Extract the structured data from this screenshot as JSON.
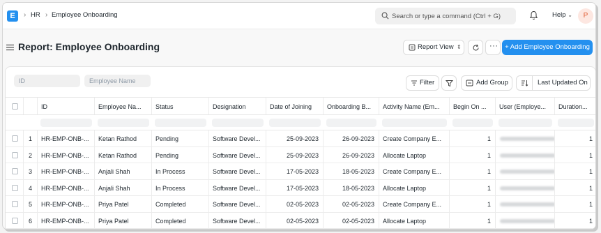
{
  "navbar": {
    "logo_letter": "E",
    "breadcrumbs": [
      "HR",
      "Employee Onboarding"
    ],
    "search_placeholder": "Search or type a command (Ctrl + G)",
    "help_label": "Help",
    "avatar_initial": "P"
  },
  "page": {
    "title": "Report: Employee Onboarding",
    "view_selector": "Report View",
    "add_button": "+ Add Employee Onboarding"
  },
  "toolbar": {
    "id_placeholder": "ID",
    "name_placeholder": "Employee Name",
    "filter_label": "Filter",
    "add_group_label": "Add Group",
    "sort_label": "Last Updated On"
  },
  "table": {
    "columns": [
      "ID",
      "Employee Na...",
      "Status",
      "Designation",
      "Date of Joining",
      "Onboarding B...",
      "Activity Name (Em...",
      "Begin On ...",
      "User (Employe...",
      "Duration..."
    ],
    "rows": [
      {
        "n": "1",
        "id": "HR-EMP-ONB-...",
        "name": "Ketan Rathod",
        "status": "Pending",
        "designation": "Software Devel...",
        "doj": "25-09-2023",
        "onb": "26-09-2023",
        "activity": "Create Company E...",
        "begin": "1",
        "duration": "1"
      },
      {
        "n": "2",
        "id": "HR-EMP-ONB-...",
        "name": "Ketan Rathod",
        "status": "Pending",
        "designation": "Software Devel...",
        "doj": "25-09-2023",
        "onb": "26-09-2023",
        "activity": "Allocate Laptop",
        "begin": "1",
        "duration": "1"
      },
      {
        "n": "3",
        "id": "HR-EMP-ONB-...",
        "name": "Anjali Shah",
        "status": "In Process",
        "designation": "Software Devel...",
        "doj": "17-05-2023",
        "onb": "18-05-2023",
        "activity": "Create Company E...",
        "begin": "1",
        "duration": "1"
      },
      {
        "n": "4",
        "id": "HR-EMP-ONB-...",
        "name": "Anjali Shah",
        "status": "In Process",
        "designation": "Software Devel...",
        "doj": "17-05-2023",
        "onb": "18-05-2023",
        "activity": "Allocate Laptop",
        "begin": "1",
        "duration": "1"
      },
      {
        "n": "5",
        "id": "HR-EMP-ONB-...",
        "name": "Priya Patel",
        "status": "Completed",
        "designation": "Software Devel...",
        "doj": "02-05-2023",
        "onb": "02-05-2023",
        "activity": "Create Company E...",
        "begin": "1",
        "duration": "1"
      },
      {
        "n": "6",
        "id": "HR-EMP-ONB-...",
        "name": "Priya Patel",
        "status": "Completed",
        "designation": "Software Devel...",
        "doj": "02-05-2023",
        "onb": "02-05-2023",
        "activity": "Allocate Laptop",
        "begin": "1",
        "duration": "1"
      }
    ]
  },
  "colors": {
    "primary": "#2490ef",
    "avatar_bg": "#fde7e1",
    "avatar_text": "#e05a30"
  }
}
